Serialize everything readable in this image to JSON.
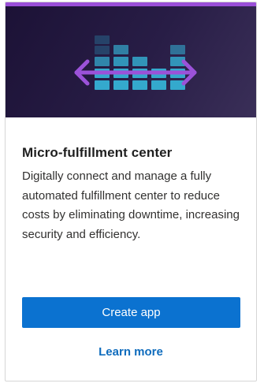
{
  "card": {
    "title": "Micro-fulfillment center",
    "description": "Digitally connect and manage a fully automated fulfillment center to reduce costs by eliminating downtime, increasing security and efficiency.",
    "primary_button_label": "Create app",
    "link_label": "Learn more"
  },
  "hero": {
    "icon": "warehouse-bars-with-double-arrow-icon",
    "accent_color": "#9a4fd8",
    "tile_color": "#2ea6c8"
  },
  "colors": {
    "button_background": "#0b72d0",
    "link": "#0f6cbd"
  }
}
